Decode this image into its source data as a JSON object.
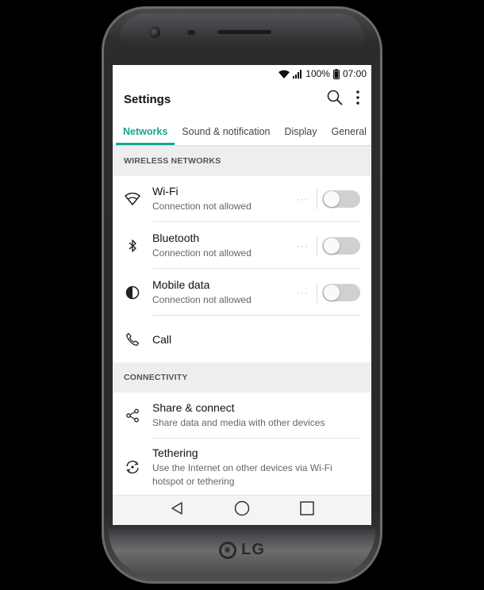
{
  "status_bar": {
    "battery": "100%",
    "time": "07:00",
    "icons": [
      "wifi-icon",
      "signal-icon",
      "battery-icon"
    ]
  },
  "app_bar": {
    "title": "Settings",
    "icons": [
      "search-icon",
      "more-vert-icon"
    ]
  },
  "tabs": [
    {
      "label": "Networks",
      "active": true
    },
    {
      "label": "Sound & notification",
      "active": false
    },
    {
      "label": "Display",
      "active": false
    },
    {
      "label": "General",
      "active": false
    }
  ],
  "sections": {
    "wireless": {
      "header": "WIRELESS NETWORKS",
      "items": [
        {
          "title": "Wi-Fi",
          "subtitle": "Connection not allowed",
          "icon": "wifi-outline-icon",
          "toggle": false
        },
        {
          "title": "Bluetooth",
          "subtitle": "Connection not allowed",
          "icon": "bluetooth-icon",
          "toggle": false
        },
        {
          "title": "Mobile data",
          "subtitle": "Connection not allowed",
          "icon": "mobile-data-icon",
          "toggle": false
        },
        {
          "title": "Call",
          "icon": "phone-icon"
        }
      ]
    },
    "connectivity": {
      "header": "CONNECTIVITY",
      "items": [
        {
          "title": "Share & connect",
          "subtitle": "Share data and media with other devices",
          "icon": "share-icon"
        },
        {
          "title": "Tethering",
          "subtitle": "Use the Internet on other devices via Wi-Fi hotspot or tethering",
          "icon": "tethering-icon"
        }
      ]
    }
  },
  "dots": "···",
  "brand": "LG",
  "colors": {
    "accent": "#1aa58f",
    "toggle_off": "#d0d0d0"
  }
}
